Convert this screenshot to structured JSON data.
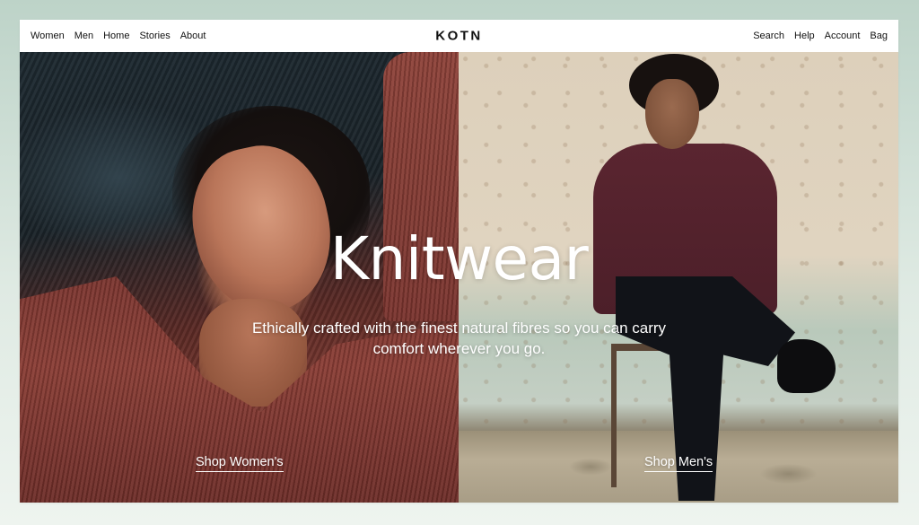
{
  "nav": {
    "left_links": [
      "Women",
      "Men",
      "Home",
      "Stories",
      "About"
    ],
    "logo": "KOTN",
    "right_links": [
      "Search",
      "Help",
      "Account",
      "Bag"
    ]
  },
  "hero": {
    "title": "Knitwear",
    "tagline": "Ethically crafted with the finest natural fibres so you can carry comfort wherever you go.",
    "cta_left": "Shop Women's",
    "cta_right": "Shop Men's"
  },
  "colors": {
    "page_background": "#cfe0d6",
    "nav_background": "#ffffff",
    "text_dark": "#111111",
    "hero_text": "#ffffff"
  }
}
